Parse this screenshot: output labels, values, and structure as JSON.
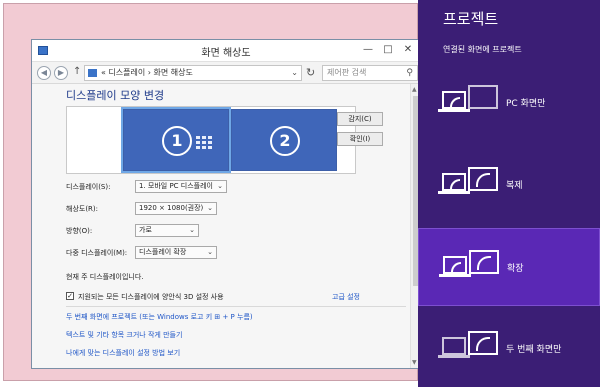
{
  "window": {
    "title": "화면 해상도",
    "minimize": "—",
    "maximize": "□",
    "close": "✕",
    "address": "« 디스플레이 › 화면 해상도",
    "search_placeholder": "제어판 검색"
  },
  "display_settings": {
    "heading": "디스플레이 모양 변경",
    "monitor_1": "1",
    "monitor_2": "2",
    "detect_button": "감지(C)",
    "identify_button": "확인(I)",
    "display_label": "디스플레이(S):",
    "display_value": "1. 모바일 PC 디스플레이",
    "resolution_label": "해상도(R):",
    "resolution_value": "1920 × 1080(권장)",
    "orientation_label": "방향(O):",
    "orientation_value": "가로",
    "multiple_label": "다중 디스플레이(M):",
    "multiple_value": "디스플레이 확장",
    "main_display_note": "현재 주 디스플레이입니다.",
    "checkbox_label": "지원되는 모든 디스플레이에 양안식 3D 설정 사용",
    "advanced_link": "고급 설정",
    "link_project": "두 번째 화면에 프로젝트 (또는 Windows 로고 키 ⊞ + P 누름)",
    "link_text_size": "텍스트 및 기타 항목 크거나 작게 만들기",
    "link_help": "나에게 맞는 디스플레이 설정 방법 보기"
  },
  "charm": {
    "title": "프로젝트",
    "subtitle": "연결된 화면에 프로젝트",
    "options": [
      {
        "label": "PC 화면만",
        "selected": false
      },
      {
        "label": "복제",
        "selected": false
      },
      {
        "label": "확장",
        "selected": true
      },
      {
        "label": "두 번째 화면만",
        "selected": false
      }
    ]
  },
  "colors": {
    "charm_bg": "#3b1e75",
    "charm_selected": "#5a28b5",
    "monitor": "#3f66b9",
    "link": "#1f56c7"
  }
}
